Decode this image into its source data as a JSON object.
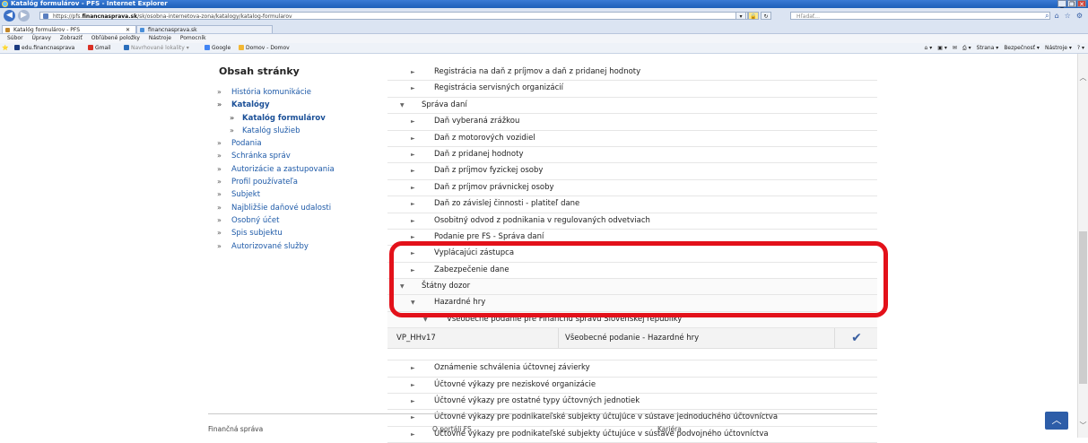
{
  "window": {
    "title": "Katalóg formulárov - PFS - Internet Explorer",
    "controls": [
      "_",
      "❐",
      "✕"
    ]
  },
  "addressbar": {
    "url_prefix": "https://pfs.",
    "url_host": "financnasprava.sk",
    "url_path": "/sk/osobna-internetova-zona/katalogy/katalog-formularov",
    "search_placeholder": "Hľadať..."
  },
  "tabs": [
    {
      "label": "Katalóg formulárov - PFS"
    },
    {
      "label": "financnasprava.sk"
    }
  ],
  "menu": [
    "Súbor",
    "Úpravy",
    "Zobraziť",
    "Obľúbené položky",
    "Nástroje",
    "Pomocník"
  ],
  "favorites": [
    {
      "label": "edu.financnasprava",
      "color": "#1b3b80"
    },
    {
      "label": "Gmail",
      "color": "#d93025"
    },
    {
      "label": "Navrhované lokality ▾",
      "color": "#2a6ebb"
    },
    {
      "label": "Google",
      "color": "#4285f4"
    },
    {
      "label": "Domov - Domov",
      "color": "#f2b733"
    }
  ],
  "commandbar": [
    "Strana ▾",
    "Bezpečnosť ▾",
    "Nástroje ▾"
  ],
  "sidebar": {
    "title": "Obsah stránky",
    "items": [
      {
        "label": "História komunikácie",
        "bullet": "»"
      },
      {
        "label": "Katalógy",
        "bullet": "»"
      },
      {
        "label": "Katalóg formulárov",
        "bullet": "»"
      },
      {
        "label": "Katalóg služieb",
        "bullet": "»"
      },
      {
        "label": "Podania",
        "bullet": "»"
      },
      {
        "label": "Schránka správ",
        "bullet": "»"
      },
      {
        "label": "Autorizácie a zastupovania",
        "bullet": "»"
      },
      {
        "label": "Profil používateľa",
        "bullet": "»"
      },
      {
        "label": "Subjekt",
        "bullet": "»"
      },
      {
        "label": "Najbližšie daňové udalosti",
        "bullet": "»"
      },
      {
        "label": "Osobný účet",
        "bullet": "»"
      },
      {
        "label": "Spis subjektu",
        "bullet": "»"
      },
      {
        "label": "Autorizované služby",
        "bullet": "»"
      }
    ]
  },
  "tree": {
    "rows": [
      {
        "label": "Registrácia na daň z príjmov a daň z pridanej hodnoty",
        "arrow": "►"
      },
      {
        "label": "Registrácia servisných organizácií",
        "arrow": "►"
      },
      {
        "label": "Správa daní",
        "arrow": "▼"
      },
      {
        "label": "Daň vyberaná zrážkou",
        "arrow": "►"
      },
      {
        "label": "Daň z motorových vozidiel",
        "arrow": "►"
      },
      {
        "label": "Daň z pridanej hodnoty",
        "arrow": "►"
      },
      {
        "label": "Daň z príjmov fyzickej osoby",
        "arrow": "►"
      },
      {
        "label": "Daň z príjmov právnickej osoby",
        "arrow": "►"
      },
      {
        "label": "Daň zo závislej činnosti - platiteľ dane",
        "arrow": "►"
      },
      {
        "label": "Osobitný odvod z podnikania v regulovaných odvetviach",
        "arrow": "►"
      },
      {
        "label": "Podanie pre FS - Správa daní",
        "arrow": "►"
      },
      {
        "label": "Vyplácajúci zástupca",
        "arrow": "►"
      },
      {
        "label": "Zabezpečenie dane",
        "arrow": "►"
      },
      {
        "label": "Štátny dozor",
        "arrow": "▼"
      },
      {
        "label": "Hazardné hry",
        "arrow": "▼"
      },
      {
        "label": "Všeobecné podanie pre Finančnú správu Slovenskej republiky",
        "arrow": "▼"
      }
    ],
    "form_row": {
      "code": "VP_HHv17",
      "name": "Všeobecné podanie - Hazardné hry"
    },
    "rows_after": [
      {
        "label": "Oznámenie schválenia účtovnej závierky",
        "arrow": "►"
      },
      {
        "label": "Účtovné výkazy pre neziskové organizácie",
        "arrow": "►"
      },
      {
        "label": "Účtovné výkazy pre ostatné typy účtovných jednotiek",
        "arrow": "►"
      },
      {
        "label": "Účtovné výkazy pre podnikateľské subjekty účtujúce v sústave jednoduchého účtovníctva",
        "arrow": "►"
      },
      {
        "label": "Účtovné výkazy pre podnikateľské subjekty účtujúce v sústave podvojného účtovníctva",
        "arrow": "►"
      }
    ]
  },
  "footer": [
    "Finančná správa",
    "O portáli FS",
    "Kariéra"
  ],
  "colors": {
    "highlight": "#e3111a",
    "link": "#1e5aa8",
    "scrolltop": "#2d5da8"
  }
}
